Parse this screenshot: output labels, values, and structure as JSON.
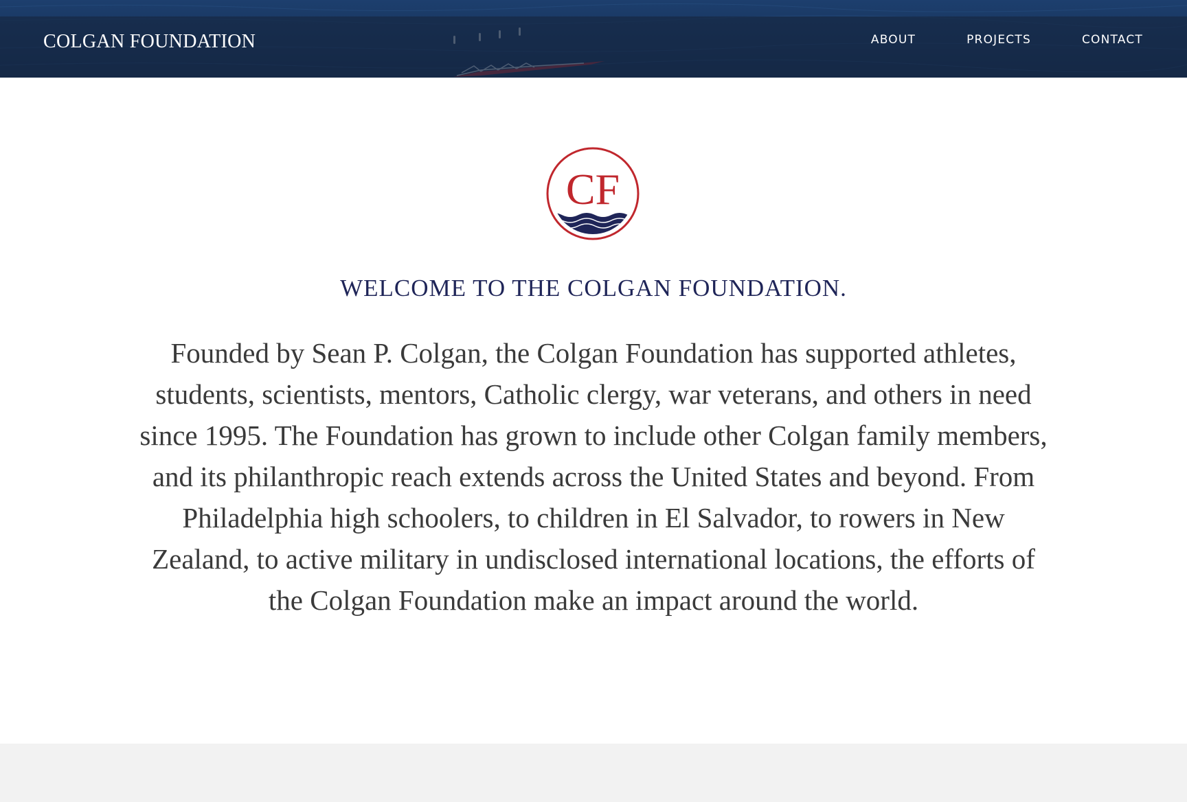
{
  "header": {
    "site_title": "COLGAN FOUNDATION",
    "nav": [
      {
        "label": "ABOUT"
      },
      {
        "label": "PROJECTS"
      },
      {
        "label": "CONTACT"
      }
    ]
  },
  "logo": {
    "monogram": "CF",
    "icon": "cf-wave-logo"
  },
  "main": {
    "heading": "WELCOME TO THE COLGAN FOUNDATION.",
    "intro": "Founded by Sean P. Colgan, the Colgan Foundation has supported athletes, students, scientists, mentors, Catholic clergy, war veterans, and others in need since 1995. The Foundation has grown to include other Colgan family members, and its philanthropic reach extends across the United States and beyond. From Philadelphia high schoolers, to children in El Salvador, to rowers in New Zealand, to active military in undisclosed international locations, the efforts of the Colgan Foundation make an impact around the world."
  },
  "colors": {
    "header_water": "#14325a",
    "heading_navy": "#1f2558",
    "logo_red": "#c0272d",
    "logo_navy": "#1f2558",
    "body_text": "#3a3a3a",
    "footer_gray": "#f2f2f2"
  }
}
